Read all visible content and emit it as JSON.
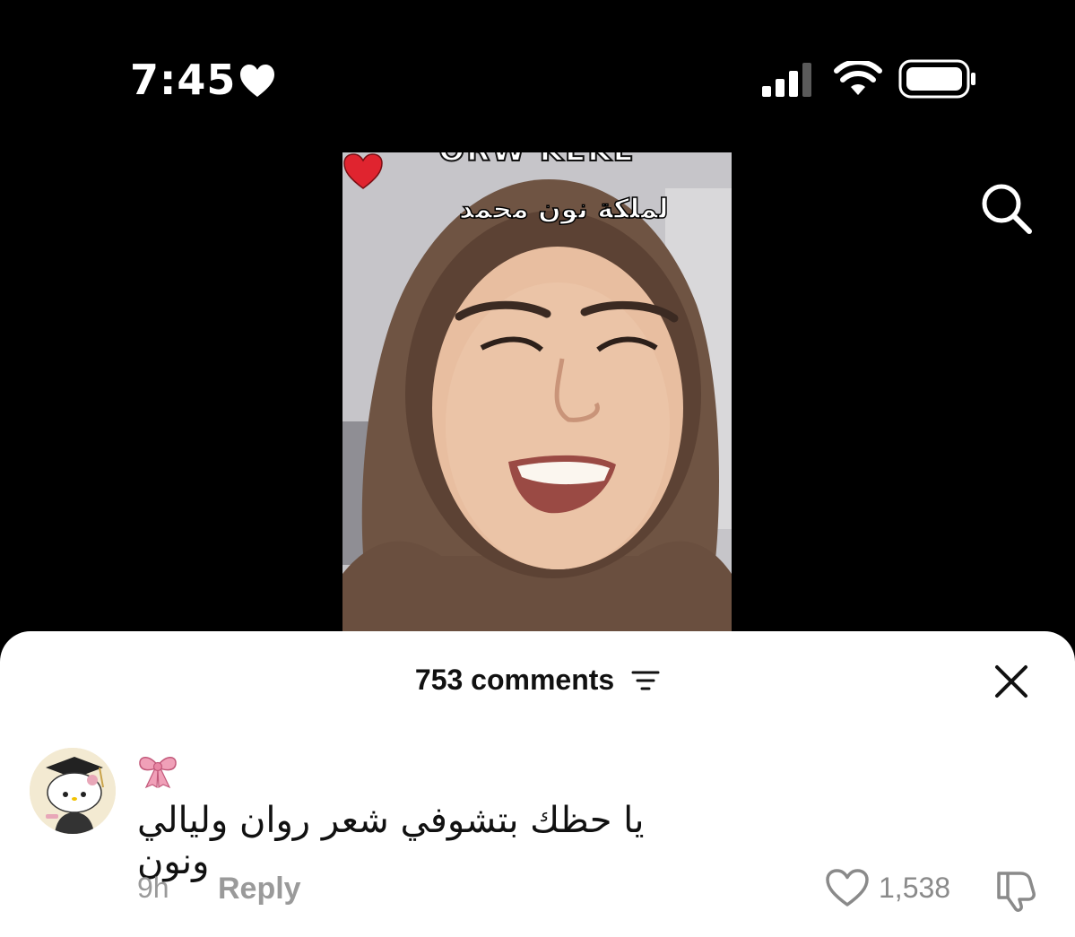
{
  "status_bar": {
    "time": "7:45",
    "icons": [
      "heart-icon",
      "cellular-signal-icon",
      "wifi-icon",
      "battery-icon"
    ]
  },
  "video": {
    "top_caption": "ORW KEKE",
    "overlay_text": "لملكة نون محمد",
    "overlay_emoji": "red-heart-icon"
  },
  "search": {
    "icon": "search-icon"
  },
  "comments": {
    "header": "753 comments",
    "filter_icon": "filter-icon",
    "close_icon": "close-icon",
    "items": [
      {
        "username_emoji": "ribbon-bow-icon",
        "text": "يا حظك بتشوفي شعر روان وليالي ونون",
        "time": "9h",
        "reply_label": "Reply",
        "likes": "1,538"
      }
    ]
  },
  "colors": {
    "background": "#000000",
    "sheet": "#ffffff",
    "muted_text": "#9a9a9a",
    "heart_red": "#e0242f"
  }
}
